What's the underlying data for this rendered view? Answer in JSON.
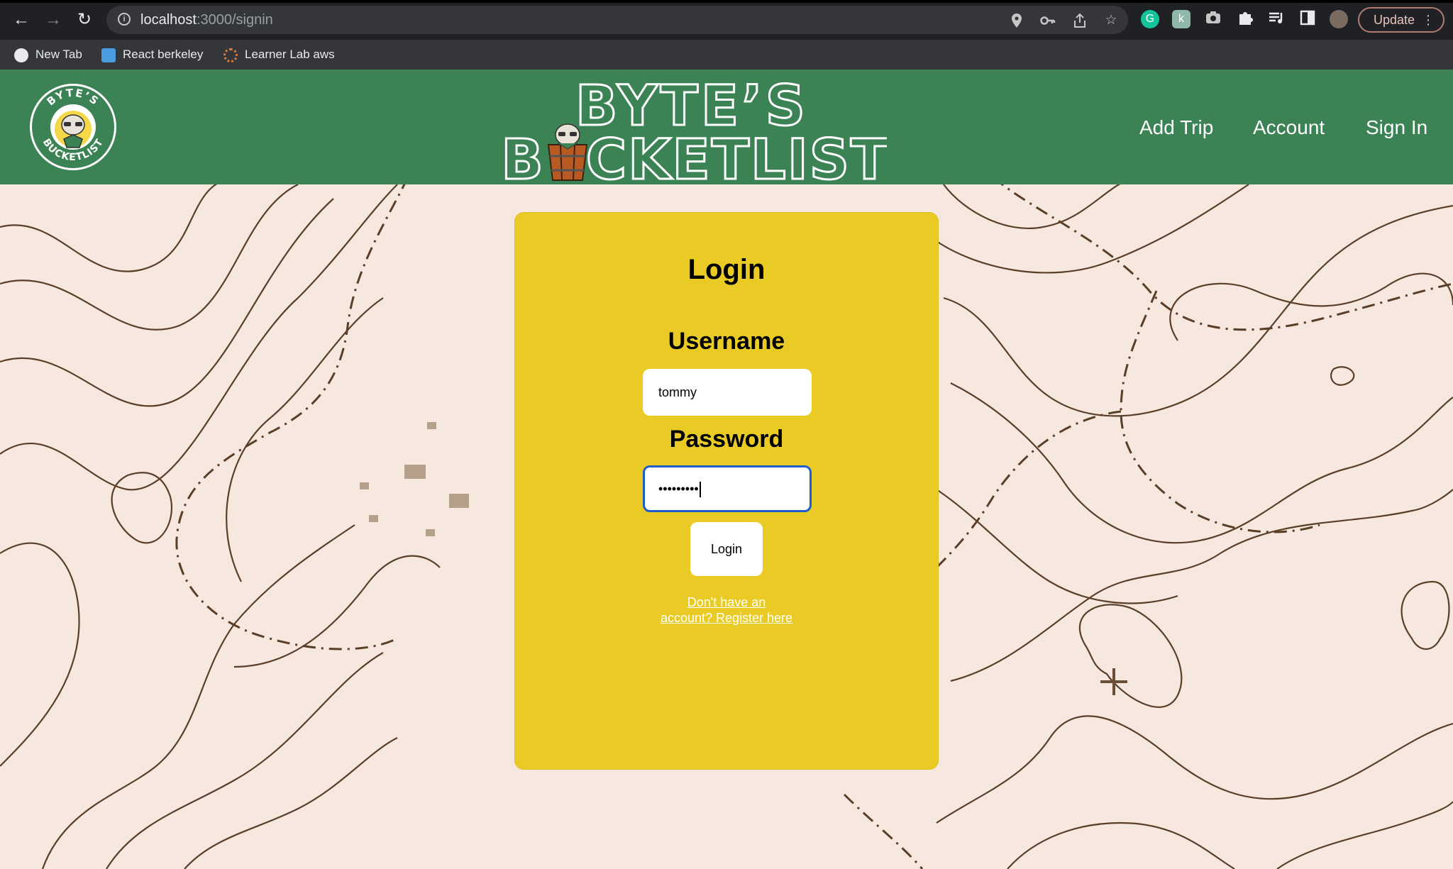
{
  "browser": {
    "url_host": "localhost",
    "url_path": ":3000/signin",
    "update_label": "Update",
    "bookmarks": [
      {
        "label": "New Tab",
        "icon": "globe-icon"
      },
      {
        "label": "React berkeley",
        "icon": "monitor-icon"
      },
      {
        "label": "Learner Lab aws",
        "icon": "aws-icon"
      }
    ]
  },
  "header": {
    "brand_line1": "BYTE’S",
    "brand_line2_a": "B",
    "brand_line2_b": "CKETLIST",
    "badge_top": "BYTE’S",
    "badge_bottom": "BUCKETLIST",
    "nav": [
      {
        "label": "Add Trip"
      },
      {
        "label": "Account"
      },
      {
        "label": "Sign In"
      }
    ],
    "header_color": "#3b8255"
  },
  "login": {
    "title": "Login",
    "username_label": "Username",
    "username_value": "tommy",
    "password_label": "Password",
    "password_value": "•••••••••",
    "button_label": "Login",
    "register_line1": "Don't have an",
    "register_line2": "account? Register here",
    "card_color": "#eacb25"
  }
}
